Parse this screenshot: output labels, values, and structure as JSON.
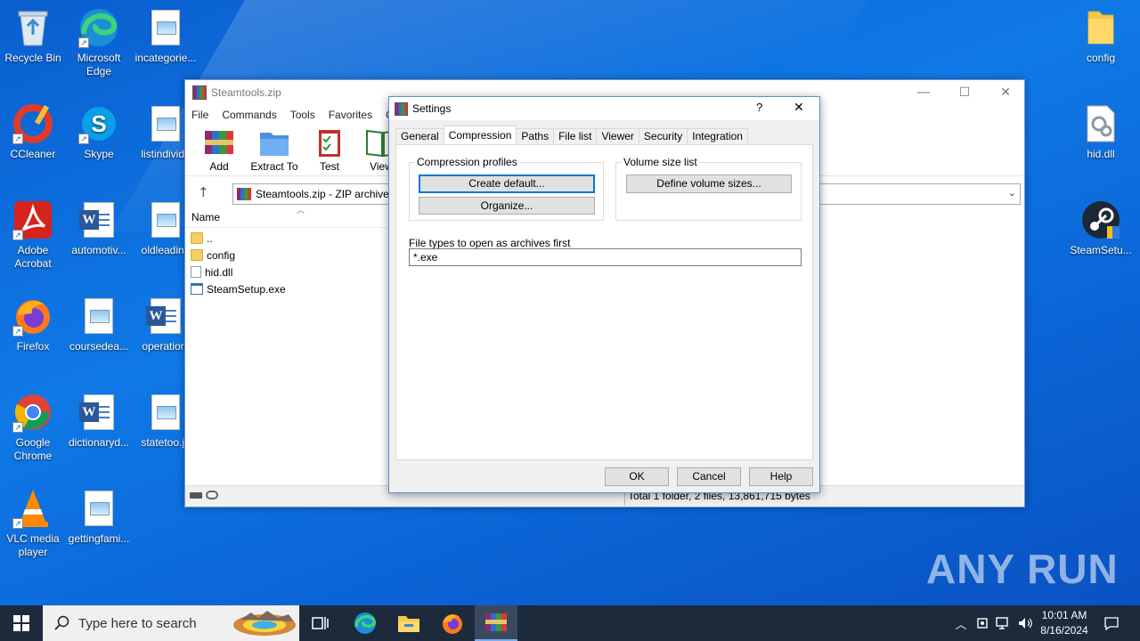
{
  "desktop": {
    "icons": [
      {
        "label": "Recycle Bin"
      },
      {
        "label": "Microsoft Edge"
      },
      {
        "label": "incategorie..."
      },
      {
        "label": "CCleaner"
      },
      {
        "label": "Skype"
      },
      {
        "label": "listindividu"
      },
      {
        "label": "Adobe Acrobat"
      },
      {
        "label": "automotiv..."
      },
      {
        "label": "oldleading"
      },
      {
        "label": "Firefox"
      },
      {
        "label": "coursedea..."
      },
      {
        "label": "operationt"
      },
      {
        "label": "Google Chrome"
      },
      {
        "label": "dictionaryd..."
      },
      {
        "label": "statetoo.jp"
      },
      {
        "label": "VLC media player"
      },
      {
        "label": "gettingfami..."
      },
      {
        "label": "config"
      },
      {
        "label": "hid.dll"
      },
      {
        "label": "SteamSetu..."
      }
    ]
  },
  "winrar": {
    "title": "Steamtools.zip",
    "menu": [
      "File",
      "Commands",
      "Tools",
      "Favorites",
      "Op"
    ],
    "toolbar": [
      "Add",
      "Extract To",
      "Test",
      "View"
    ],
    "address": "Steamtools.zip - ZIP archive,",
    "column_name": "Name",
    "files": [
      {
        "name": "..",
        "type": "folder"
      },
      {
        "name": "config",
        "type": "folder"
      },
      {
        "name": "hid.dll",
        "type": "dll"
      },
      {
        "name": "SteamSetup.exe",
        "type": "exe"
      }
    ],
    "status": "Total 1 folder, 2 files, 13,861,715 bytes"
  },
  "settings_dialog": {
    "title": "Settings",
    "help_glyph": "?",
    "close_glyph": "✕",
    "tabs": [
      "General",
      "Compression",
      "Paths",
      "File list",
      "Viewer",
      "Security",
      "Integration"
    ],
    "active_tab": "Compression",
    "compression_profiles": {
      "label": "Compression profiles",
      "create_default": "Create default...",
      "organize": "Organize..."
    },
    "volume_size": {
      "label": "Volume size list",
      "define": "Define volume sizes..."
    },
    "file_types": {
      "label": "File types to open as archives first",
      "value": "*.exe"
    },
    "buttons": {
      "ok": "OK",
      "cancel": "Cancel",
      "help": "Help"
    }
  },
  "taskbar": {
    "search_placeholder": "Type here to search",
    "time": "10:01 AM",
    "date": "8/16/2024"
  },
  "watermark": "ANY RUN"
}
